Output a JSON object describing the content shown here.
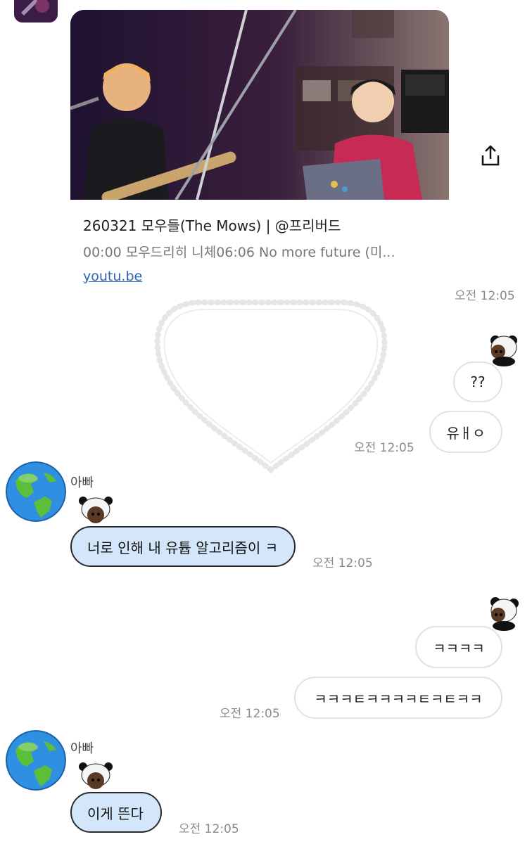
{
  "link_preview": {
    "title": "260321 모우들(The Mows) | @프리버드",
    "description": "00:00 모우드리히 니체06:06 No more future (미...",
    "url": "youtu.be",
    "timestamp": "오전 12:05"
  },
  "messages": {
    "me_1": {
      "bubble_1": "??",
      "bubble_2": "유ㅐㅇ",
      "timestamp": "오전 12:05"
    },
    "dad_1": {
      "sender": "아빠",
      "text": "너로 인해 내 유튭 알고리즘이 ㅋ",
      "timestamp": "오전 12:05"
    },
    "me_2": {
      "bubble_1": "ㅋㅋㅋㅋ",
      "bubble_2": "ㅋㅋㅋㅌㅋㅋㅋㅋㅌㅋㅌㅋㅋ",
      "timestamp": "오전 12:05"
    },
    "dad_2": {
      "sender": "아빠",
      "text": "이게 뜬다",
      "timestamp": "오전 12:05"
    }
  },
  "colors": {
    "dad_bubble": "#d4e6fa",
    "link": "#2a64b4",
    "timestamp": "#8a8a8a"
  },
  "icons": [
    "share-icon",
    "globe-avatar",
    "panda-sticker",
    "heart-frame"
  ]
}
